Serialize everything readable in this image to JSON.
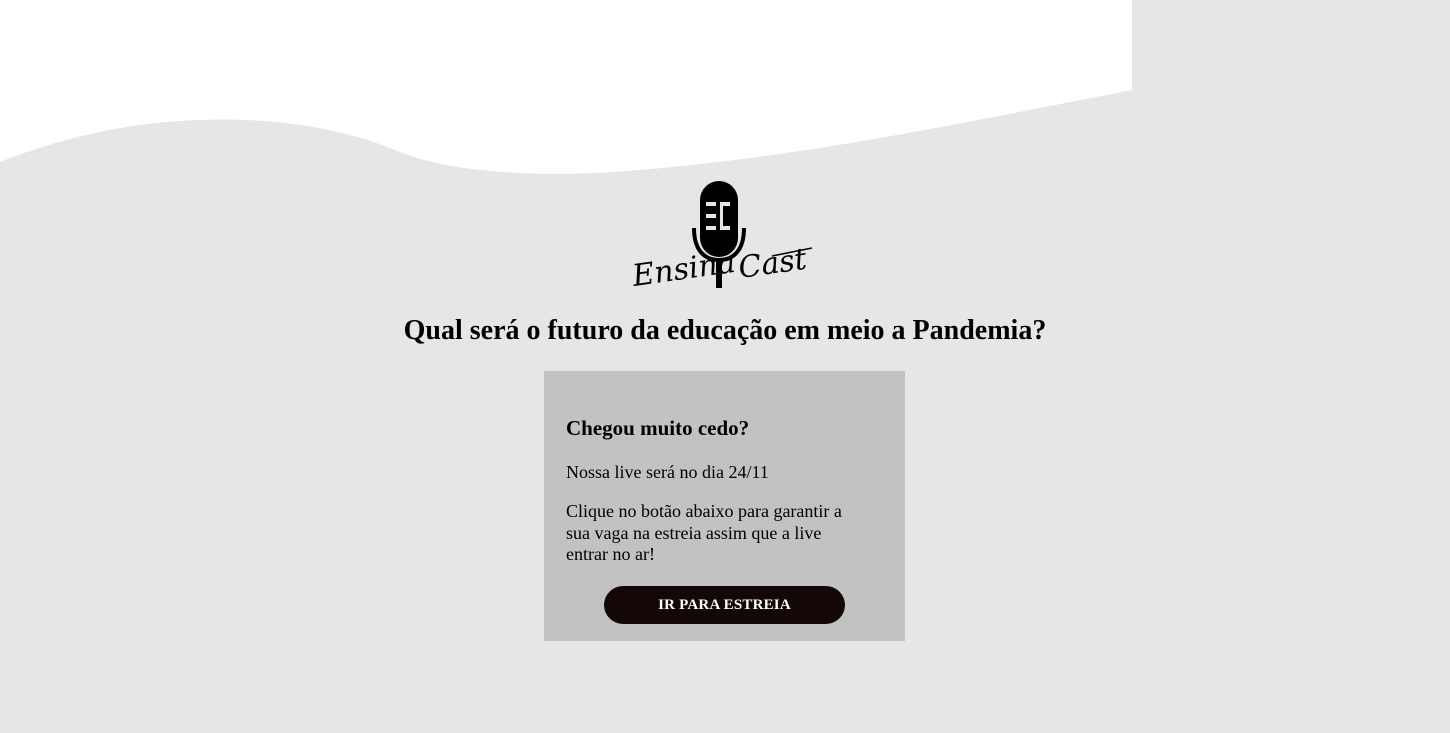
{
  "logo": {
    "left_text": "Ensina",
    "right_text": "Cast",
    "icon": "microphone-icon"
  },
  "hero": {
    "headline": "Qual será o futuro da educação em meio a Pandemia?"
  },
  "card": {
    "title": "Chegou muito cedo?",
    "date_text": "Nossa live será no dia 24/11",
    "description": "Clique no botão abaixo para garantir a sua vaga na estreia assim que a live entrar no ar!",
    "button_label": "IR PARA ESTREIA"
  },
  "colors": {
    "page_background": "#e6e6e6",
    "wave_white": "#ffffff",
    "card_background": "#c2c2c2",
    "button_background": "#130707",
    "button_text": "#ffffff",
    "text": "#000000"
  }
}
